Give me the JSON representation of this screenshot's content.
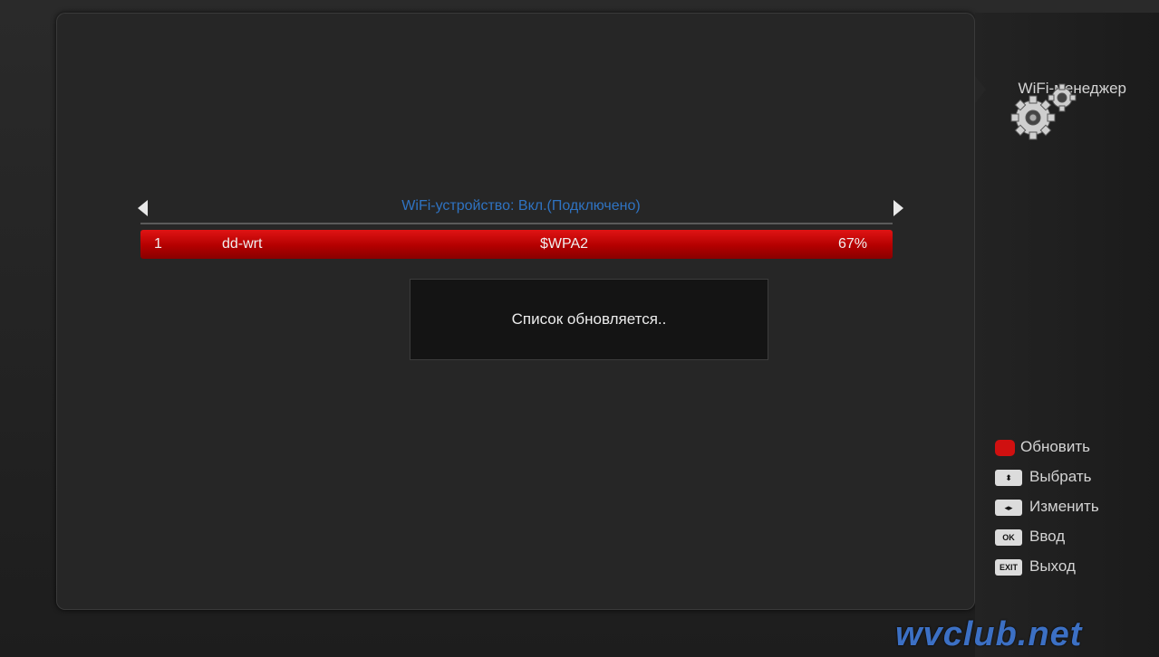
{
  "header": {
    "title": "WiFi-менеджер"
  },
  "device": {
    "status": "WiFi-устройство: Вкл.(Подключено)"
  },
  "networks": [
    {
      "num": "1",
      "ssid": "dd-wrt",
      "security": "$WPA2",
      "signal": "67%"
    }
  ],
  "popup": {
    "message": "Список обновляется.."
  },
  "legend": {
    "refresh": {
      "label": "Обновить",
      "color": "#d01010"
    },
    "select": {
      "icon": "⬍",
      "label": "Выбрать"
    },
    "change": {
      "icon": "◂▸",
      "label": "Изменить"
    },
    "ok": {
      "icon": "OK",
      "label": "Ввод"
    },
    "exit": {
      "icon": "EXIT",
      "label": "Выход"
    }
  },
  "watermark": "wvclub.net",
  "colors": {
    "accent_blue": "#2f73c2",
    "selection_red": "#d01010",
    "panel": "#262626"
  }
}
